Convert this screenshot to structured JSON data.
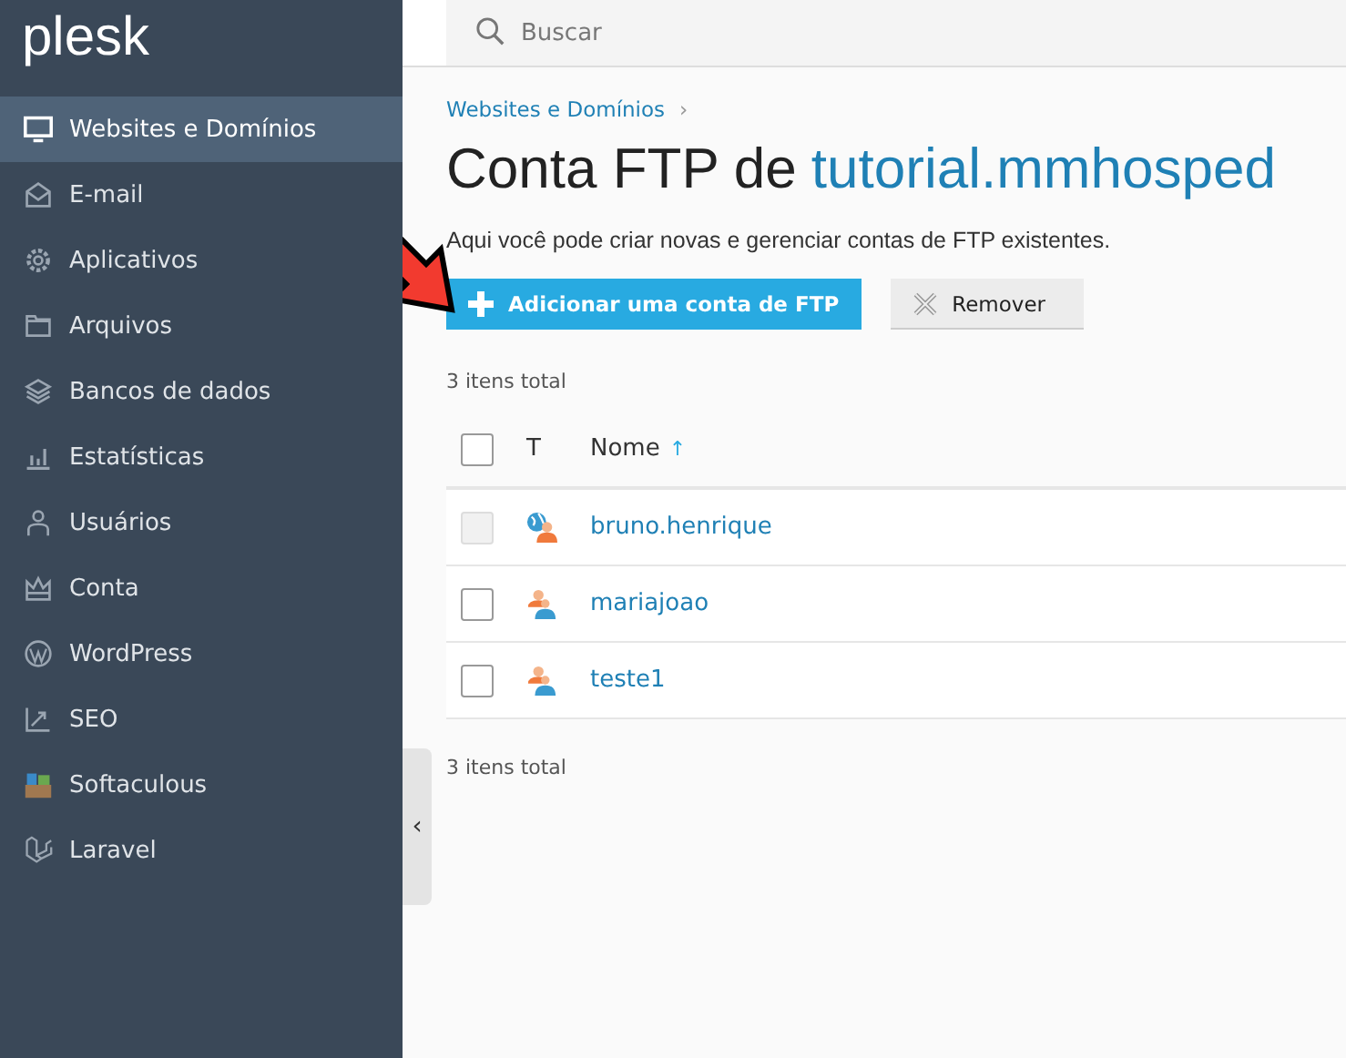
{
  "sidebar": {
    "logo": "plesk",
    "items": [
      {
        "label": "Websites e Domínios",
        "selected": true
      },
      {
        "label": "E-mail",
        "selected": false
      },
      {
        "label": "Aplicativos",
        "selected": false
      },
      {
        "label": "Arquivos",
        "selected": false
      },
      {
        "label": "Bancos de dados",
        "selected": false
      },
      {
        "label": "Estatísticas",
        "selected": false
      },
      {
        "label": "Usuários",
        "selected": false
      },
      {
        "label": "Conta",
        "selected": false
      },
      {
        "label": "WordPress",
        "selected": false
      },
      {
        "label": "SEO",
        "selected": false
      },
      {
        "label": "Softaculous",
        "selected": false
      },
      {
        "label": "Laravel",
        "selected": false
      }
    ],
    "collapse_handle": "‹"
  },
  "search": {
    "placeholder": "Buscar"
  },
  "breadcrumb": {
    "items": [
      "Websites e Domínios"
    ],
    "separator": "›"
  },
  "title": {
    "prefix": "Conta FTP de",
    "link": "tutorial.mmhosped"
  },
  "description": "Aqui você pode criar novas e gerenciar contas de FTP existentes.",
  "buttons": [
    {
      "label": "Adicionar uma conta de FTP",
      "kind": "primary"
    },
    {
      "label": "Remover",
      "kind": "remove"
    }
  ],
  "total_top": "3 itens total",
  "table": {
    "select_all_checked": false,
    "columns": [
      "T",
      "Nome"
    ],
    "sort_indicator": "↑",
    "rows": [
      {
        "name": "bruno.henrique",
        "kind": "web-user",
        "checked": false,
        "disabled": true
      },
      {
        "name": "mariajoao",
        "kind": "user",
        "checked": false,
        "disabled": false
      },
      {
        "name": "teste1",
        "kind": "user",
        "checked": false,
        "disabled": false
      }
    ]
  },
  "total_bottom": "3 itens total"
}
